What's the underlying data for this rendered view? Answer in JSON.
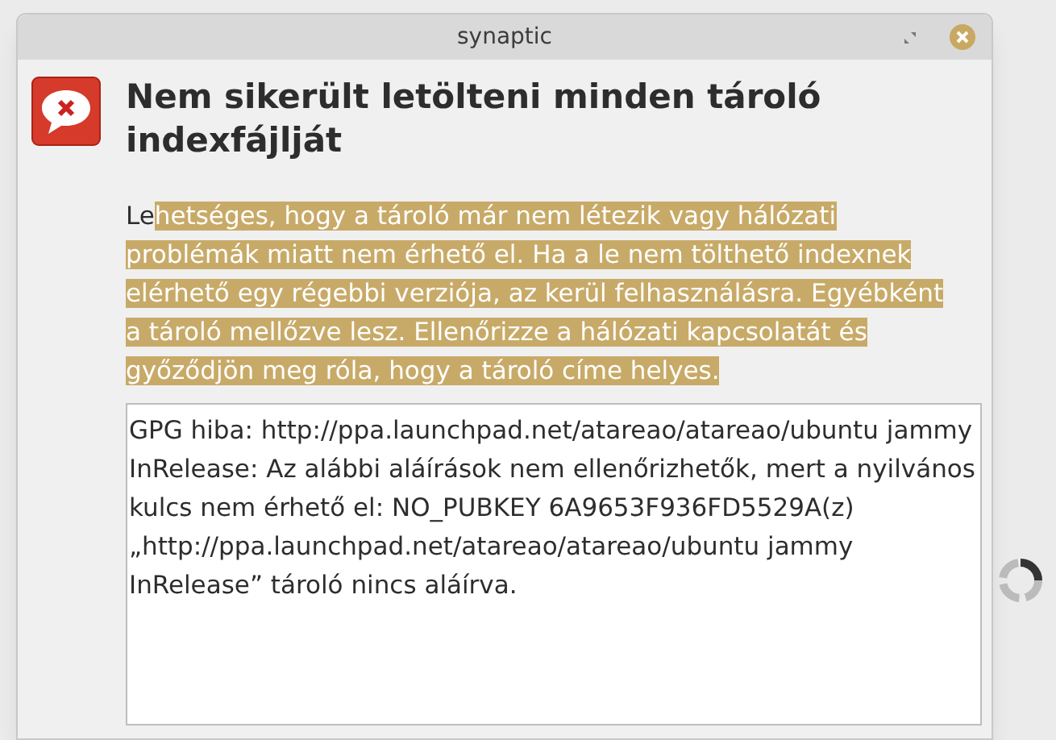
{
  "window": {
    "title": "synaptic"
  },
  "heading": "Nem sikerült letölteni minden tároló indexfájlját",
  "message": {
    "text_before_selection": "Le",
    "selected_text": "hetséges, hogy a tároló már nem létezik vagy hálózati problémák miatt nem érhető el. Ha a le nem tölthető indexnek elérhető egy régebbi verziója, az kerül felhasználásra. Egyébként a tároló mellőzve lesz. Ellenőrizze a hálózati kapcsolatát és győződjön meg róla, hogy a tároló címe helyes."
  },
  "details": "GPG hiba: http://ppa.launchpad.net/atareao/atareao/ubuntu jammy InRelease: Az alábbi aláírások nem ellenőrizhetők, mert a nyilvános kulcs nem érhető el: NO_PUBKEY 6A9653F936FD5529A(z) „http://ppa.launchpad.net/atareao/atareao/ubuntu jammy InRelease” tároló nincs aláírva."
}
